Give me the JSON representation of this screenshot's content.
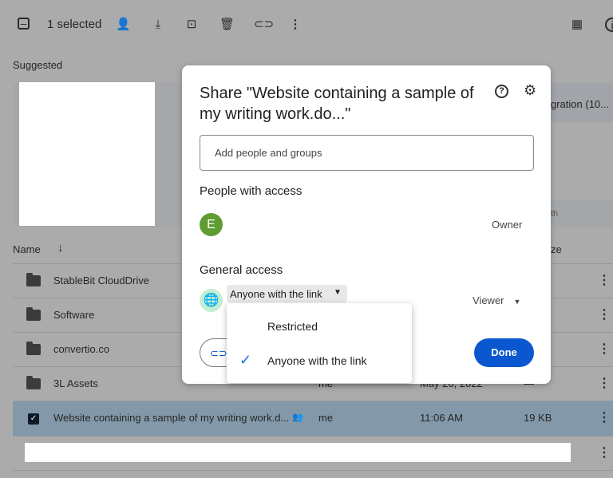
{
  "toolbar": {
    "selected_label": "1 selected",
    "icons": [
      "deselect-icon",
      "share-icon",
      "download-icon",
      "move-icon",
      "trash-icon",
      "link-icon",
      "more-icon",
      "grid-view-icon",
      "info-icon"
    ]
  },
  "suggested": {
    "heading": "Suggested",
    "card_right_title": "gration (10...",
    "card_right_footer": "th"
  },
  "list": {
    "name_header": "Name",
    "size_header": "ze",
    "rows": [
      {
        "name": "StableBit CloudDrive"
      },
      {
        "name": "Software"
      },
      {
        "name": "convertio.co"
      },
      {
        "name": "3L Assets",
        "owner": "me",
        "modified": "May 26, 2022",
        "size": "—"
      },
      {
        "name": "Website containing a sample of my writing work.d...",
        "owner": "me",
        "modified": "11:06 AM",
        "size": "19 KB",
        "selected": true,
        "shared": true
      }
    ]
  },
  "dialog": {
    "title": "Share \"Website containing a sample of my writing work.do...\"",
    "add_placeholder": "Add people and groups",
    "people_heading": "People with access",
    "owner_initial": "E",
    "owner_role": "Owner",
    "avatar_color": "#5f9c32",
    "general_heading": "General access",
    "access_value": "Anyone with the link",
    "role_value": "Viewer",
    "done_label": "Done",
    "accent": "#0b57d0"
  },
  "access_menu": {
    "options": [
      {
        "label": "Restricted",
        "checked": false
      },
      {
        "label": "Anyone with the link",
        "checked": true
      }
    ]
  }
}
